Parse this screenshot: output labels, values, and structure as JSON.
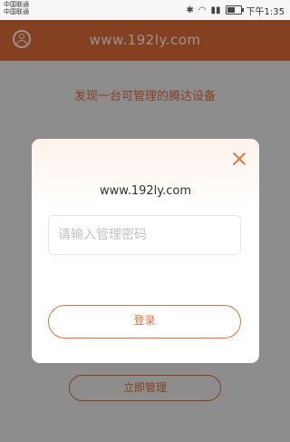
{
  "status_bar": {
    "carrier_line1": "中国联通",
    "carrier_line2": "中国联通",
    "time": "下午1:35",
    "battery_level": 0.6
  },
  "header": {
    "title": "www.192ly.com",
    "bg_color": "#e66f3a"
  },
  "main": {
    "found_text": "发现一台可管理的腾达设备",
    "manage_button": "立即管理"
  },
  "dialog": {
    "title": "www.192ly.com",
    "password_placeholder": "请输入管理密码",
    "login_button": "登录"
  },
  "icons": {
    "user": "user-circle-icon",
    "close": "close-icon"
  }
}
